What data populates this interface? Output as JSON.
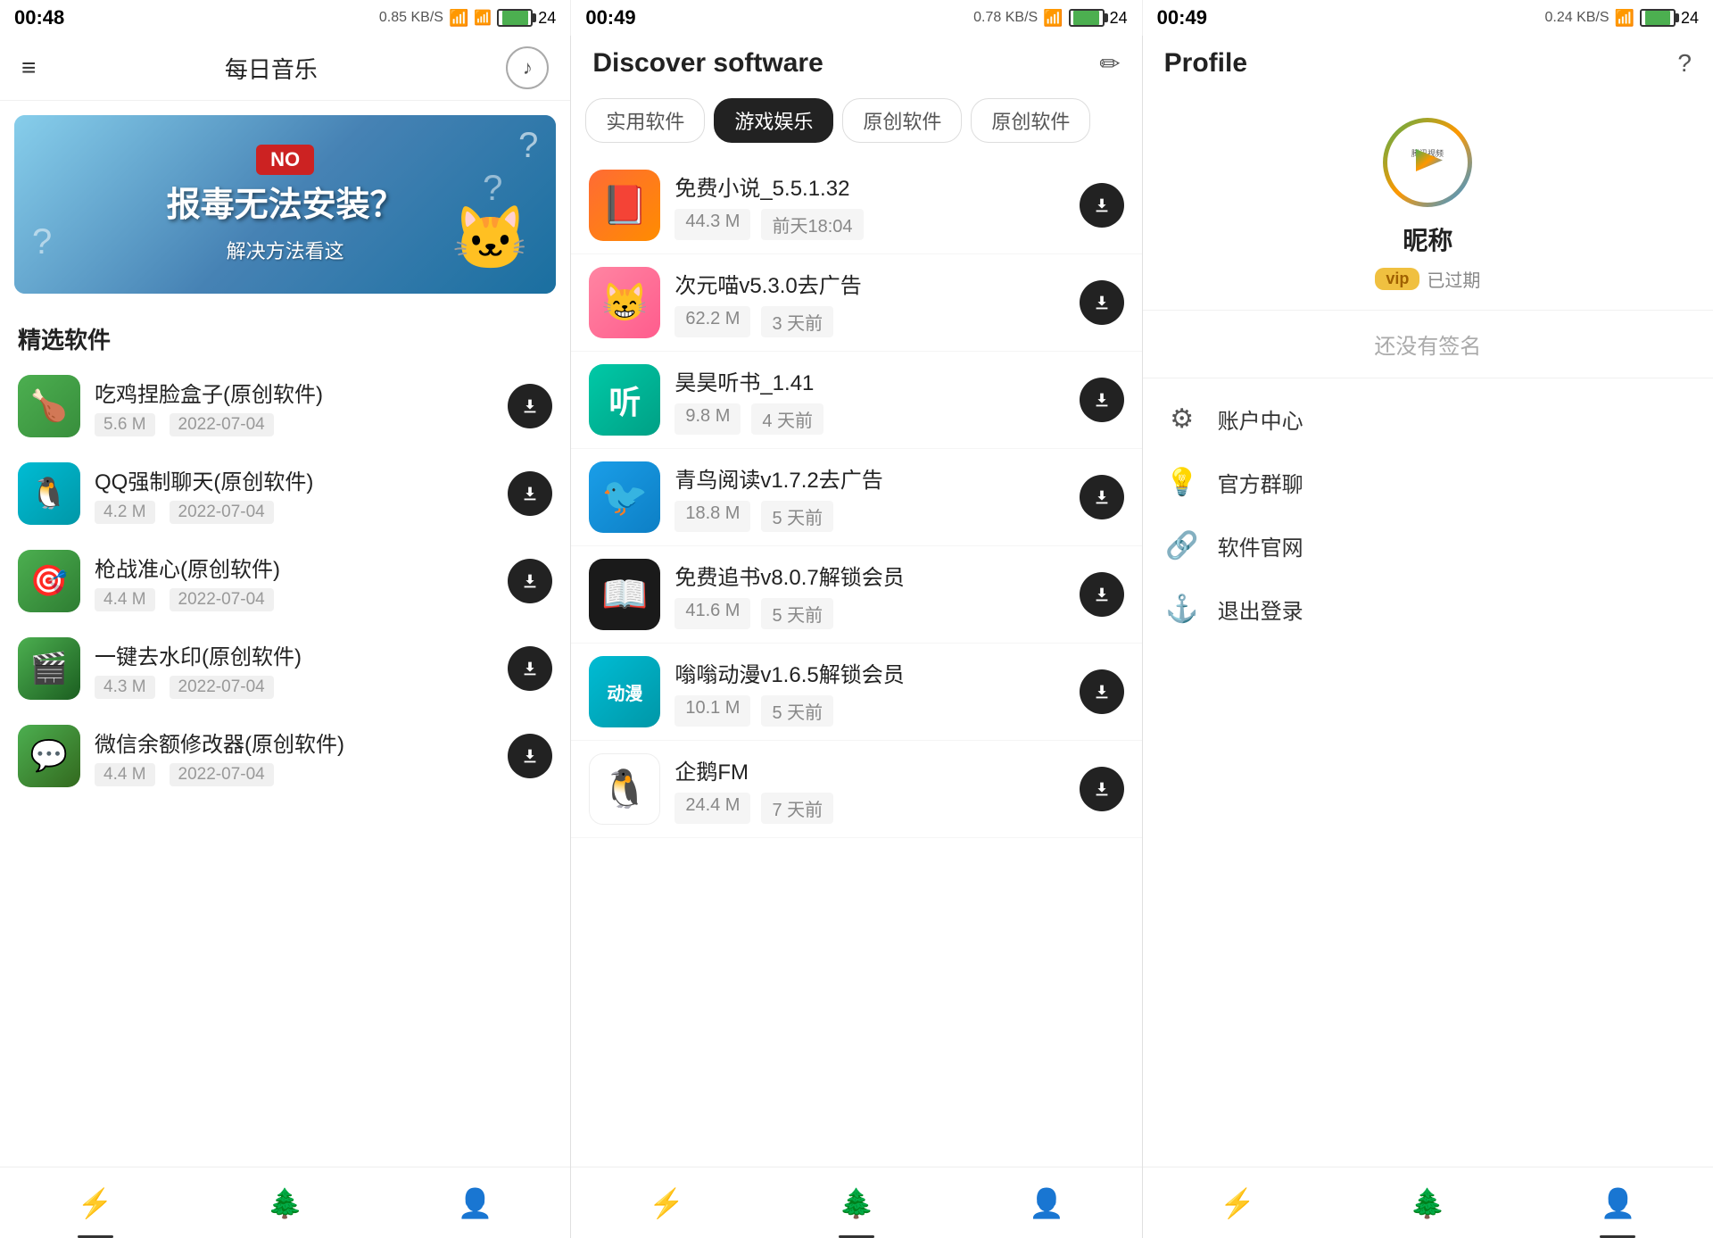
{
  "statusBars": [
    {
      "time": "00:48",
      "network": "0.85 KB/S",
      "wifi": true,
      "signal1": true,
      "signal2": true,
      "battery": "24"
    },
    {
      "time": "00:49",
      "network": "0.78 KB/S",
      "wifi": true,
      "signal1": true,
      "signal2": true,
      "battery": "24"
    },
    {
      "time": "00:49",
      "network": "0.24 KB/S",
      "wifi": true,
      "signal1": true,
      "signal2": true,
      "battery": "24"
    }
  ],
  "panel1": {
    "menuIcon": "≡",
    "title": "每日音乐",
    "sectionTitle": "精选软件",
    "banner": {
      "noBadge": "NO",
      "mainText": "报毒无法安装？",
      "subText": "解决方法看这"
    },
    "apps": [
      {
        "name": "吃鸡捏脸盒子(原创软件)",
        "size": "5.6 M",
        "date": "2022-07-04",
        "iconColor": "green",
        "iconEmoji": "🍗"
      },
      {
        "name": "QQ强制聊天(原创软件)",
        "size": "4.2 M",
        "date": "2022-07-04",
        "iconColor": "teal",
        "iconEmoji": "🐧"
      },
      {
        "name": "枪战准心(原创软件)",
        "size": "4.4 M",
        "date": "2022-07-04",
        "iconColor": "target",
        "iconEmoji": "🎯"
      },
      {
        "name": "一键去水印(原创软件)",
        "size": "4.3 M",
        "date": "2022-07-04",
        "iconColor": "media",
        "iconEmoji": "🎬"
      },
      {
        "name": "微信余额修改器(原创软件)",
        "size": "4.4 M",
        "date": "2022-07-04",
        "iconColor": "wechat",
        "iconEmoji": "💬"
      }
    ],
    "nav": [
      {
        "icon": "⚡",
        "label": "home",
        "active": true
      },
      {
        "icon": "🌲",
        "label": "discover"
      },
      {
        "icon": "👤",
        "label": "profile"
      }
    ]
  },
  "panel2": {
    "title": "Discover software",
    "editIcon": "✏",
    "filterTabs": [
      {
        "label": "实用软件",
        "active": false
      },
      {
        "label": "游戏娱乐",
        "active": true
      },
      {
        "label": "原创软件",
        "active": false
      },
      {
        "label": "原创软件",
        "active": false
      }
    ],
    "apps": [
      {
        "name": "免费小说_5.5.1.32",
        "size": "44.3 M",
        "date": "前天18:04",
        "iconType": "novel",
        "iconEmoji": "📕"
      },
      {
        "name": "次元喵v5.3.0去广告",
        "size": "62.2 M",
        "date": "3 天前",
        "iconType": "anime-girl",
        "iconEmoji": "😸"
      },
      {
        "name": "昊昊听书_1.41",
        "size": "9.8 M",
        "date": "4 天前",
        "iconType": "audio",
        "iconText": "听"
      },
      {
        "name": "青鸟阅读v1.7.2去广告",
        "size": "18.8 M",
        "date": "5 天前",
        "iconType": "bird",
        "iconEmoji": "🐦"
      },
      {
        "name": "免费追书v8.0.7解锁会员",
        "size": "41.6 M",
        "date": "5 天前",
        "iconType": "book-free",
        "iconEmoji": "📖"
      },
      {
        "name": "嗡嗡动漫v1.6.5解锁会员",
        "size": "10.1 M",
        "date": "5 天前",
        "iconType": "comic",
        "iconText": "动漫"
      },
      {
        "name": "企鹅FM",
        "size": "24.4 M",
        "date": "7 天前",
        "iconType": "penguin",
        "iconEmoji": "🐧"
      }
    ],
    "nav": [
      {
        "icon": "⚡",
        "label": "home"
      },
      {
        "icon": "🌲",
        "label": "discover",
        "active": true
      },
      {
        "icon": "👤",
        "label": "profile"
      }
    ]
  },
  "panel3": {
    "title": "Profile",
    "helpIcon": "?",
    "avatar": {
      "type": "tencent-video",
      "label": "腾讯视频"
    },
    "nickname": "昵称",
    "vipLabel": "vip",
    "vipStatus": "已过期",
    "noSignature": "还没有签名",
    "menuItems": [
      {
        "icon": "⚙",
        "label": "账户中心",
        "iconName": "settings-icon"
      },
      {
        "icon": "💡",
        "label": "官方群聊",
        "iconName": "group-icon"
      },
      {
        "icon": "🔗",
        "label": "软件官网",
        "iconName": "link-icon"
      },
      {
        "icon": "⚓",
        "label": "退出登录",
        "iconName": "logout-icon"
      }
    ],
    "nav": [
      {
        "icon": "⚡",
        "label": "home"
      },
      {
        "icon": "🌲",
        "label": "discover"
      },
      {
        "icon": "👤",
        "label": "profile",
        "active": true
      }
    ]
  }
}
